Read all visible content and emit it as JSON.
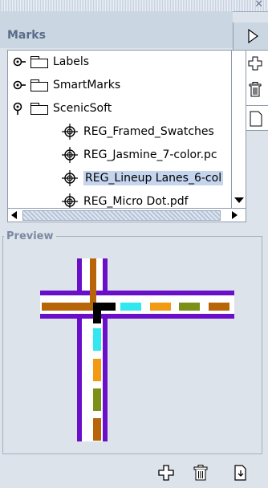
{
  "panel": {
    "title": "Marks",
    "close_glyph": "✕"
  },
  "tree": {
    "items": [
      {
        "label": "Labels",
        "type": "folder",
        "expander": "collapsed"
      },
      {
        "label": "SmartMarks",
        "type": "folder",
        "expander": "collapsed"
      },
      {
        "label": "ScenicSoft",
        "type": "folder",
        "expander": "expanded"
      },
      {
        "label": "REG_Framed_Swatches",
        "type": "mark",
        "icon": "registration-mark-icon"
      },
      {
        "label": "REG_Jasmine_7-color.pc",
        "type": "mark",
        "icon": "registration-mark-icon"
      },
      {
        "label": "REG_Lineup Lanes_6-col",
        "type": "mark",
        "icon": "registration-mark-icon",
        "selected": true
      },
      {
        "label": "REG_Micro Dot.pdf",
        "type": "mark",
        "icon": "registration-mark-icon"
      }
    ]
  },
  "preview": {
    "title": "Preview"
  },
  "bottom_toolbar": {
    "buttons": [
      {
        "icon": "add-mark-icon"
      },
      {
        "icon": "trash-icon"
      },
      {
        "icon": "import-icon"
      }
    ]
  },
  "colors": {
    "purple": "#6a0fc9",
    "brown": "#b8650a",
    "cyan": "#32e7f0",
    "orange": "#f29a12",
    "green": "#7c8f17",
    "black": "#000000"
  }
}
